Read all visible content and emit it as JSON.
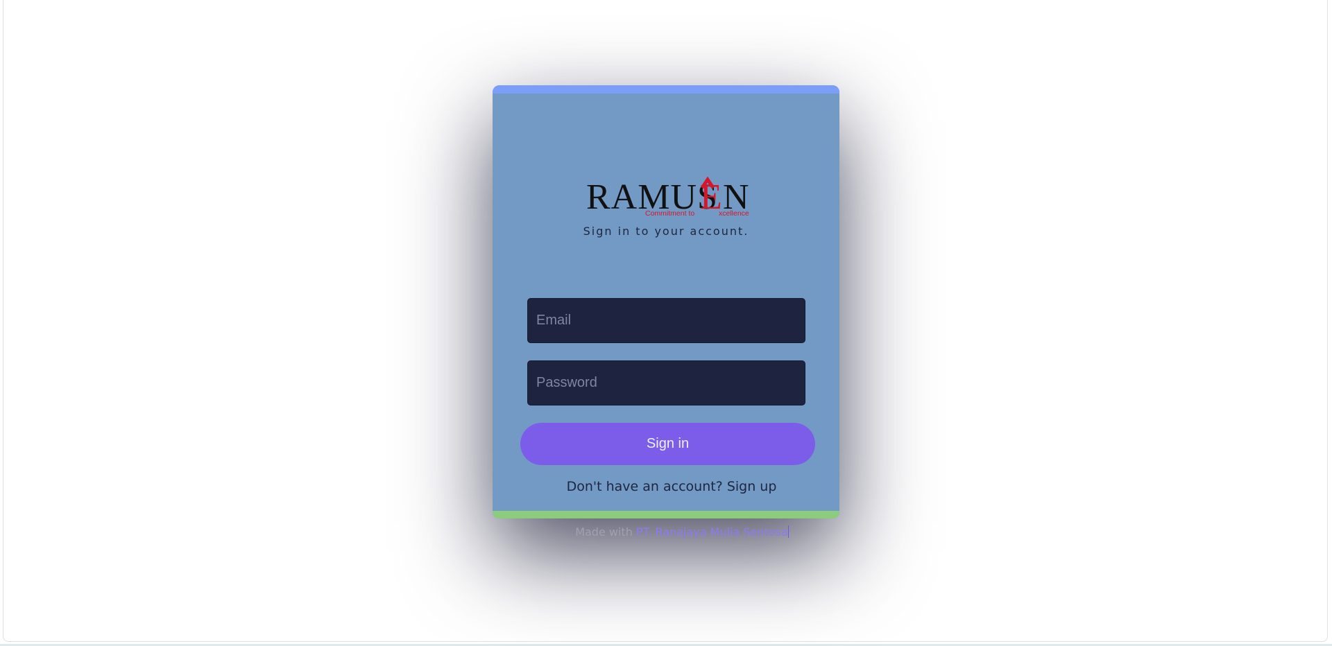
{
  "brand": {
    "logo_text": "RAMUSEN",
    "tagline": "Commitment to Excellence",
    "logo_color": "#111111",
    "accent_color": "#d6162b"
  },
  "card": {
    "subtitle": "Sign in to your account.",
    "background": "#739ac4",
    "top_bar_color": "#7b9ef8",
    "bottom_bar_color": "#8ccd7d"
  },
  "form": {
    "email_placeholder": "Email",
    "email_value": "",
    "password_placeholder": "Password",
    "password_value": "",
    "submit_label": "Sign in",
    "submit_color": "#7c5de9"
  },
  "signup": {
    "prompt": "Don't have an account?",
    "link_label": "Sign up"
  },
  "footer": {
    "prefix": "Made with",
    "company": "PT. Ranajaya Mulia Sentosa"
  }
}
